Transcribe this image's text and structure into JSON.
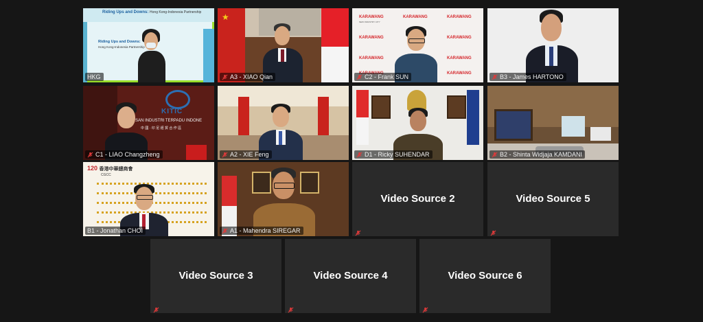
{
  "participants": [
    {
      "name": "HKG",
      "speaking": true
    },
    {
      "name": "A3 - XIAO Qian"
    },
    {
      "name": "C2 - Frank SUN"
    },
    {
      "name": "B3 - James HARTONO"
    },
    {
      "name": "C1 - LIAO Changzheng"
    },
    {
      "name": "A2 - XIE Feng"
    },
    {
      "name": "D1 - Ricky SUHENDAR"
    },
    {
      "name": "B2 - Shinta Widjaja KAMDANI"
    },
    {
      "name": "B1 - Jonathan CHOI"
    },
    {
      "name": "A1 - Mahendra SIREGAR"
    }
  ],
  "video_sources": [
    {
      "title": "Video Source 2"
    },
    {
      "title": "Video Source 5"
    },
    {
      "title": "Video Source 3"
    },
    {
      "title": "Video Source 4"
    },
    {
      "title": "Video Source 6"
    }
  ],
  "hkg_slide": {
    "title": "Riding Ups and Downs:",
    "subtitle": "Hong Kong-Indonesia Partnership",
    "side_title": "Riding Ups and Downs:",
    "side_subtitle": "Hong Kong-Indonesia Partnership"
  },
  "karawang": {
    "brand": "KARAWANG",
    "tagline": "NEW INDUSTRY CITY"
  },
  "kitic": {
    "logo_text": "KITIC",
    "banner": "SAN INDUSTRI TERPADU INDONE",
    "chinese": "中 國 · 印 尼 經 貿 合 作 區"
  },
  "cgcc": {
    "badge": "120",
    "chinese": "香港中華總商會",
    "abbr": "CGCC"
  },
  "colors": {
    "speaking_border": "#9be02c",
    "muted_mic": "#e03a3a",
    "tile_bg": "#2a2a2a",
    "page_bg": "#161616"
  }
}
